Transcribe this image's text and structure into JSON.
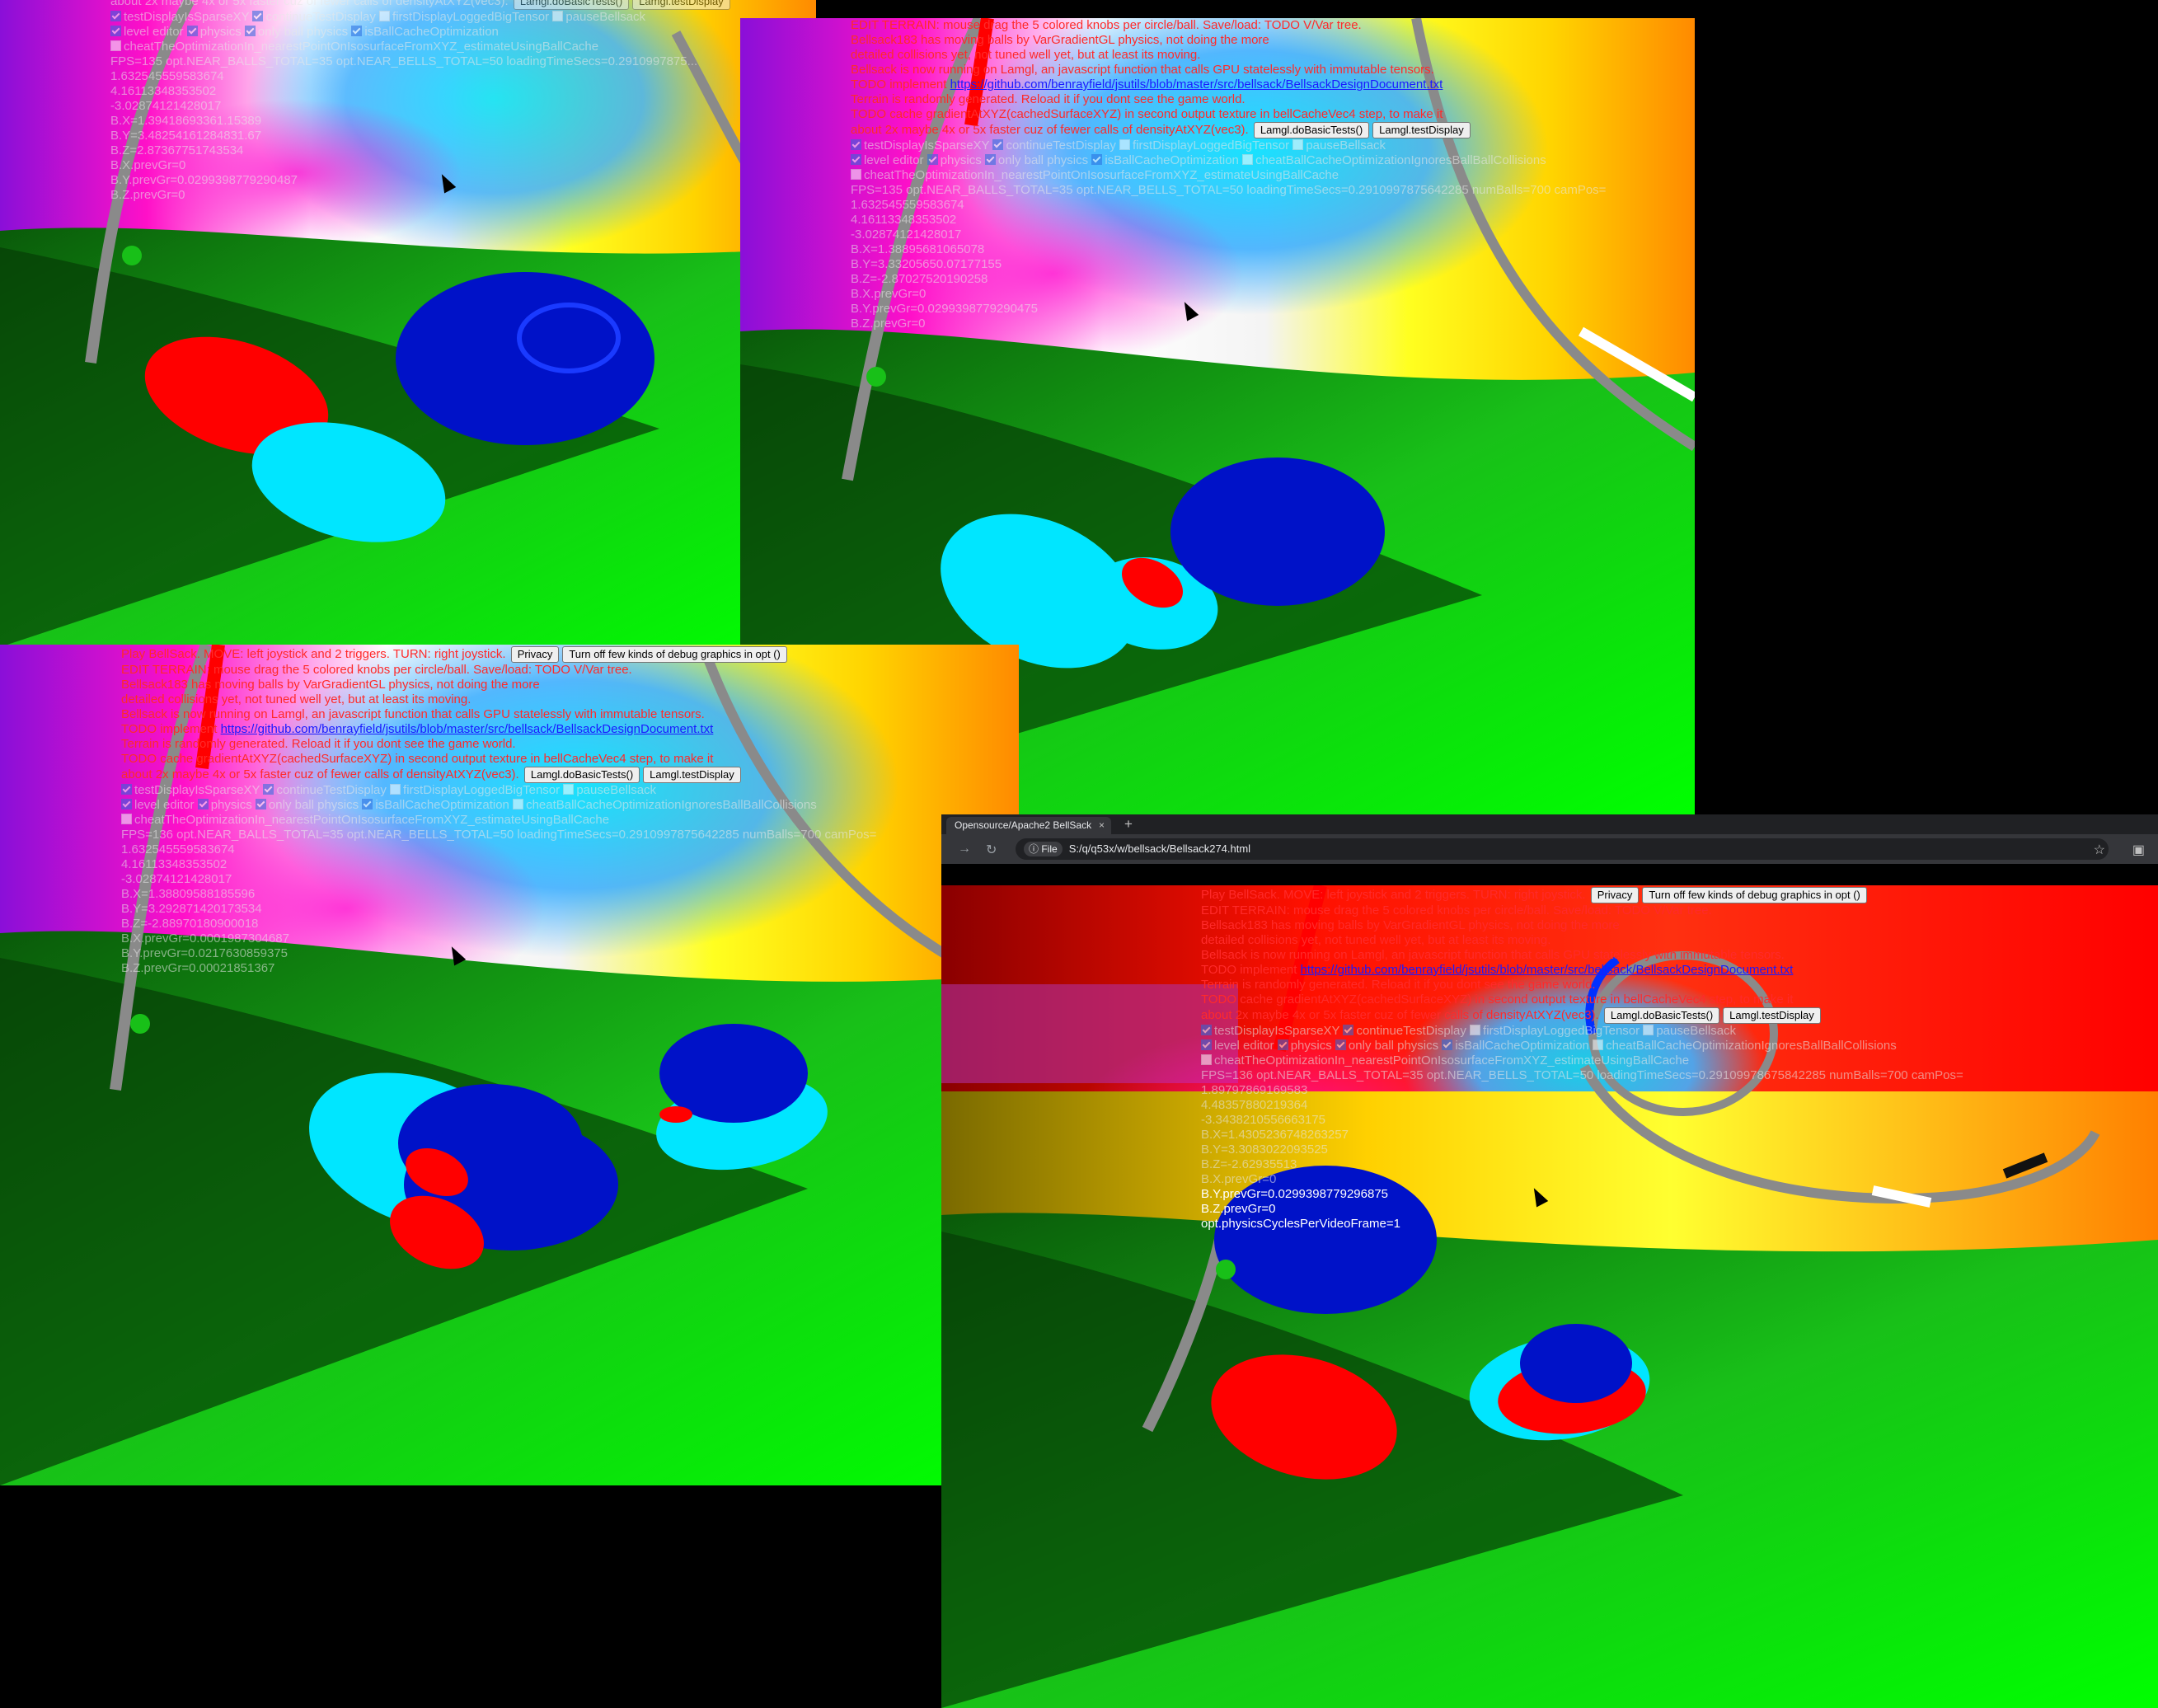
{
  "browser": {
    "tab_title": "Opensource/Apache2 BellSack",
    "tab_close": "×",
    "new_tab": "+",
    "url_chip": "File",
    "url": "S:/q/q53x/w/bellsack/Bellsack274.html"
  },
  "ui": {
    "line_play": "Play BellSack. MOVE: left joystick and 2 triggers. TURN: right joystick.",
    "privacy_button": "Privacy",
    "debug_button": "Turn off few kinds of debug graphics in opt ()",
    "line_edit": "EDIT TERRAIN: mouse drag the 5 colored knobs per circle/ball. Save/load: TODO V/Var tree.",
    "line_physics_1": "Bellsack183 has moving balls by VarGradientGL physics, not doing the more",
    "line_physics_2": "detailed collisions yet, not tuned well yet, but at least its moving.",
    "line_lamgl": "Bellsack is now running on Lamgl, an javascript function that calls GPU statelessly with immutable tensors.",
    "line_todo_prefix": "TODO implement",
    "todo_link": "https://github.com/benrayfield/jsutils/blob/master/src/bellsack/BellsackDesignDocument.txt",
    "line_terrain": "Terrain is randomly generated. Reload it if you dont see the game world.",
    "line_todo_cache": "TODO cache gradientAtXYZ(cachedSurfaceXYZ) in second output texture in bellCacheVec4 step, to make it",
    "line_faster": "about 2x maybe 4x or 5x faster cuz of fewer calls of densityAtXYZ(vec3).",
    "basic_tests_button": "Lamgl.doBasicTests()",
    "test_display_button": "Lamgl.testDisplay",
    "checkboxes_row1": [
      {
        "label": "testDisplayIsSparseXY",
        "checked": true
      },
      {
        "label": "continueTestDisplay",
        "checked": true
      },
      {
        "label": "firstDisplayLoggedBigTensor",
        "checked": false
      },
      {
        "label": "pauseBellsack",
        "checked": false
      }
    ],
    "checkboxes_row2": [
      {
        "label": "level editor",
        "checked": true
      },
      {
        "label": "physics",
        "checked": true
      },
      {
        "label": "only ball physics",
        "checked": true
      },
      {
        "label": "isBallCacheOptimization",
        "checked": true
      },
      {
        "label": "cheatBallCacheOptimizationIgnoresBallBallCollisions",
        "checked": false
      }
    ],
    "checkboxes_row3": [
      {
        "label": "cheatTheOptimizationIn_nearestPointOnIsosurfaceFromXYZ_estimateUsingBallCache",
        "checked": false
      }
    ]
  },
  "instances": [
    {
      "fps_line": "FPS=135 opt.NEAR_BALLS_TOTAL=35 opt.NEAR_BELLS_TOTAL=50 loadingTimeSecs=0.2910997875...",
      "values": [
        "1.632545559583674",
        "4.16113348353502",
        "-3.02874121428017",
        "B.X=1.39418693361.15389",
        "B.Y=3.48254161284831.67",
        "B.Z=2.87367751743534",
        "B.X.prevGr=0",
        "B.Y.prevGr=0.0299398779290487",
        "B.Z.prevGr=0"
      ]
    },
    {
      "fps_line": "FPS=135 opt.NEAR_BALLS_TOTAL=35 opt.NEAR_BELLS_TOTAL=50 loadingTimeSecs=0.2910997875642285 numBalls=700 camPos=",
      "values": [
        "1.632545559583674",
        "4.16113348353502",
        "-3.02874121428017",
        "B.X=1.38895681065078",
        "B.Y=3.33205650.07177155",
        "B.Z=-2.87027520190258",
        "B.X.prevGr=0",
        "B.Y.prevGr=0.0299398779290475",
        "B.Z.prevGr=0"
      ]
    },
    {
      "fps_line": "FPS=136 opt.NEAR_BALLS_TOTAL=35 opt.NEAR_BELLS_TOTAL=50 loadingTimeSecs=0.2910997875642285 numBalls=700 camPos=",
      "values": [
        "1.632545559583674",
        "4.16113348353502",
        "-3.02874121428017",
        "B.X=1.38809588185596",
        "B.Y=3.292871420173534",
        "B.Z=-2.88970180900018",
        "B.X.prevGr=0.0001987304687",
        "B.Y.prevGr=0.0217630859375",
        "B.Z.prevGr=0.00021851367"
      ]
    },
    {
      "fps_line": "FPS=136 opt.NEAR_BALLS_TOTAL=35 opt.NEAR_BELLS_TOTAL=50 loadingTimeSecs=0.29109978675842285 numBalls=700 camPos=",
      "values": [
        "1.89797869169583",
        "4.48357880219364",
        "-3.3438210556663175",
        "B.X=1.4305236748263257",
        "B.Y=3.3083022093525",
        "B.Z=-2.62935513",
        "B.X.prevGr=0",
        "B.Y.prevGr=0.0299398779296875",
        "B.Z.prevGr=0",
        "opt.physicsCyclesPerVideoFrame=1"
      ]
    }
  ]
}
